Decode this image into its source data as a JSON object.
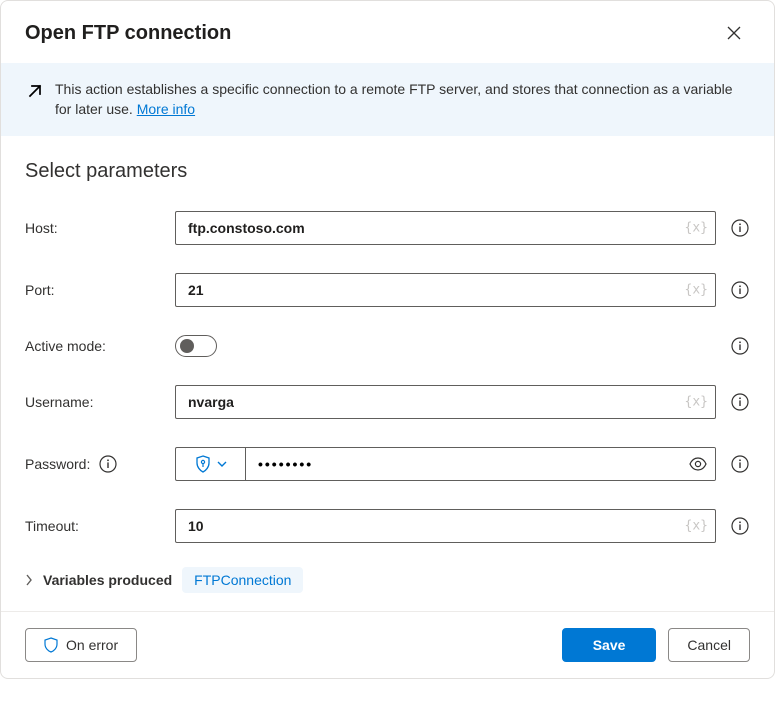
{
  "header": {
    "title": "Open FTP connection"
  },
  "banner": {
    "text": "This action establishes a specific connection to a remote FTP server, and stores that connection as a variable for later use.",
    "link_label": "More info"
  },
  "section_title": "Select parameters",
  "fields": {
    "host": {
      "label": "Host:",
      "value": "ftp.constoso.com"
    },
    "port": {
      "label": "Port:",
      "value": "21"
    },
    "active_mode": {
      "label": "Active mode:",
      "value": false
    },
    "username": {
      "label": "Username:",
      "value": "nvarga"
    },
    "password": {
      "label": "Password:",
      "value": "••••••••"
    },
    "timeout": {
      "label": "Timeout:",
      "value": "10"
    }
  },
  "variables": {
    "label": "Variables produced",
    "item": "FTPConnection"
  },
  "footer": {
    "on_error": "On error",
    "save": "Save",
    "cancel": "Cancel"
  },
  "var_hint": "{x}"
}
